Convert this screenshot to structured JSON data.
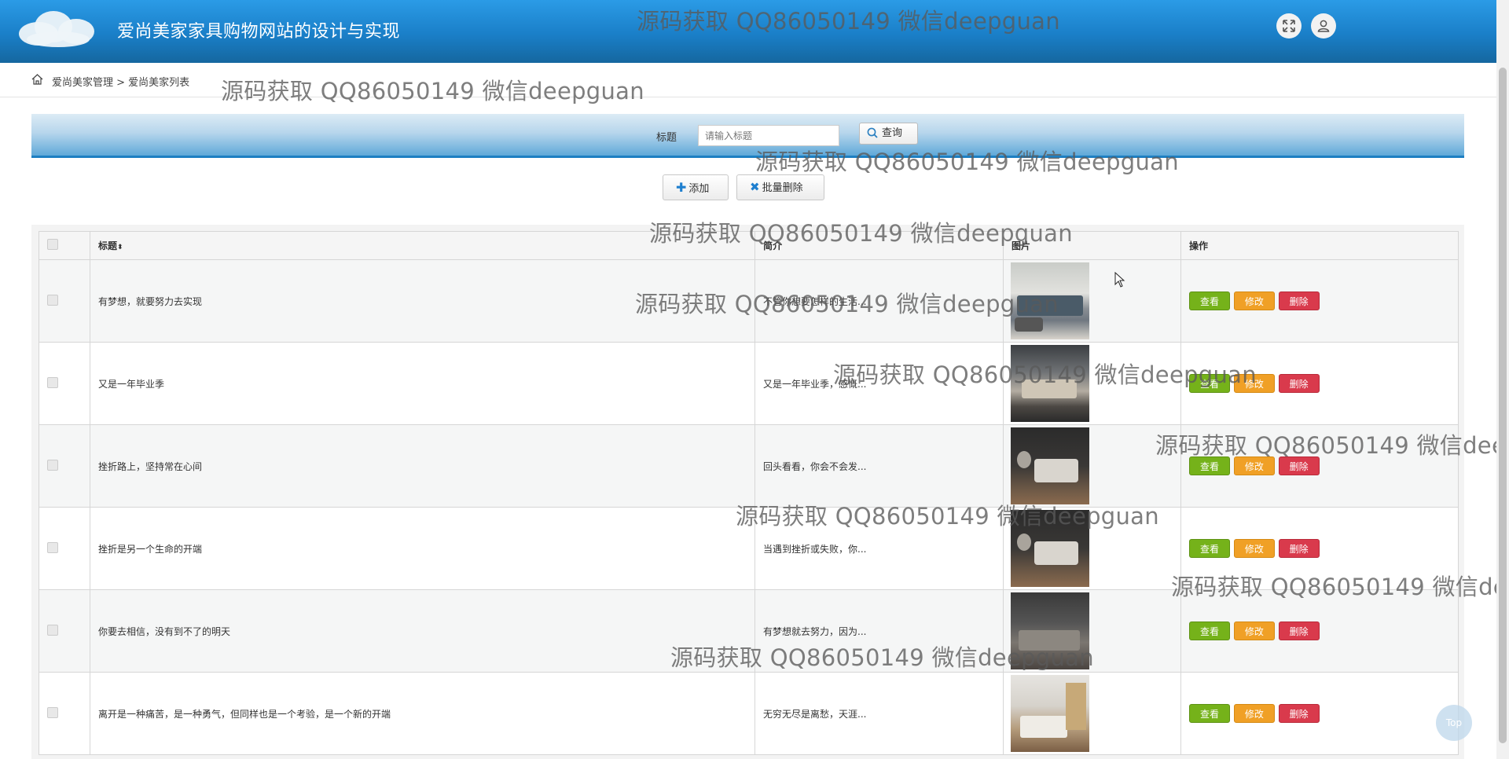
{
  "header": {
    "title": "爱尚美家家具购物网站的设计与实现",
    "fullscreen_icon": "expand-icon",
    "user_icon": "user-icon"
  },
  "breadcrumb": {
    "text": "爱尚美家管理 > 爱尚美家列表"
  },
  "search": {
    "label": "标题",
    "placeholder": "请输入标题",
    "button_label": "查询"
  },
  "toolbar": {
    "add_label": "添加",
    "batch_delete_label": "批量删除"
  },
  "table": {
    "headers": {
      "title": "标题",
      "intro": "简介",
      "image": "图片",
      "actions": "操作"
    },
    "rows": [
      {
        "title": "有梦想，就要努力去实现",
        "intro": "不管你想要怎样的生活..."
      },
      {
        "title": "又是一年毕业季",
        "intro": "又是一年毕业季，感慨..."
      },
      {
        "title": "挫折路上，坚持常在心间",
        "intro": "回头看看，你会不会发..."
      },
      {
        "title": "挫折是另一个生命的开端",
        "intro": "当遇到挫折或失败，你..."
      },
      {
        "title": "你要去相信，没有到不了的明天",
        "intro": "有梦想就去努力，因为..."
      },
      {
        "title": "离开是一种痛苦，是一种勇气，但同样也是一个考验，是一个新的开端",
        "intro": "无穷无尽是离愁，天涯..."
      }
    ],
    "actions": {
      "view": "查看",
      "edit": "修改",
      "delete": "删除"
    }
  },
  "back_to_top": "Top",
  "watermark": "源码获取 QQ86050149 微信deepguan",
  "colors": {
    "header_blue": "#1a7fc8",
    "view_green": "#75b21a",
    "edit_orange": "#f0a026",
    "delete_red": "#d93a4c"
  }
}
